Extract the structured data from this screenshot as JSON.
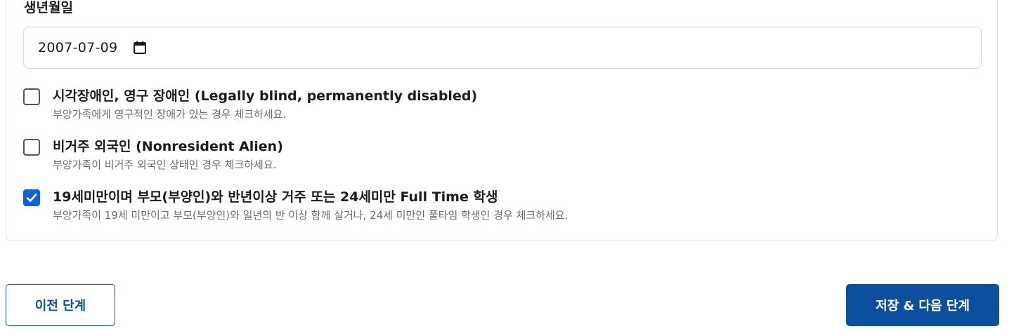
{
  "birth": {
    "label": "생년월일",
    "value": "2007-07-09"
  },
  "options": [
    {
      "title": "시각장애인, 영구 장애인 (Legally blind, permanently disabled)",
      "desc": "부양가족에게 영구적인 장애가 있는 경우 체크하세요.",
      "checked": false
    },
    {
      "title": "비거주 외국인 (Nonresident Alien)",
      "desc": "부양가족이 비거주 외국인 상태인 경우 체크하세요.",
      "checked": false
    },
    {
      "title": "19세미만이며 부모(부양인)와 반년이상 거주 또는 24세미만 Full Time 학생",
      "desc": "부양가족이 19세 미만이고 부모(부양인)와 일년의 반 이상 함께 살거나, 24세 미만인 풀타임 학생인 경우 체크하세요.",
      "checked": true
    }
  ],
  "buttons": {
    "prev": "이전 단계",
    "next": "저장 & 다음 단계"
  },
  "colors": {
    "primary": "#0b4f9e",
    "checkbox_checked": "#0f62d6"
  },
  "icons": {
    "date": "calendar-icon",
    "check": "checkmark-icon"
  }
}
